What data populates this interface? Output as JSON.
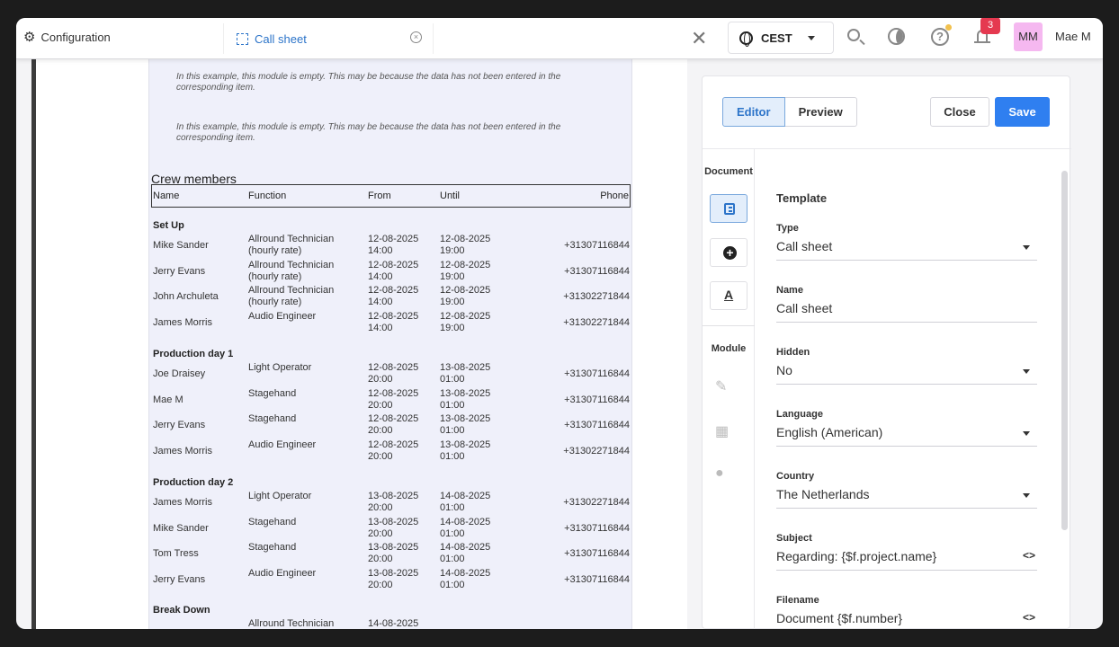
{
  "topbar": {
    "config_label": "Configuration",
    "tab_label": "Call sheet",
    "timezone": "CEST",
    "notification_count": "3",
    "avatar_initials": "MM",
    "username": "Mae M"
  },
  "document": {
    "empty_note": "In this example, this module is empty. This may be because the data has not been entered in the corresponding item.",
    "crew_title": "Crew members",
    "columns": [
      "Name",
      "Function",
      "From",
      "Until",
      "Phone"
    ],
    "sections": [
      {
        "title": "Set Up",
        "rows": [
          {
            "name": "Mike Sander",
            "function": "Allround Technician (hourly rate)",
            "from": "12-08-2025 14:00",
            "until": "12-08-2025 19:00",
            "phone": "+31307116844"
          },
          {
            "name": "Jerry Evans",
            "function": "Allround Technician (hourly rate)",
            "from": "12-08-2025 14:00",
            "until": "12-08-2025 19:00",
            "phone": "+31307116844"
          },
          {
            "name": "John Archuleta",
            "function": "Allround Technician (hourly rate)",
            "from": "12-08-2025 14:00",
            "until": "12-08-2025 19:00",
            "phone": "+31302271844"
          },
          {
            "name": "James Morris",
            "function": "Audio Engineer",
            "from": "12-08-2025 14:00",
            "until": "12-08-2025 19:00",
            "phone": "+31302271844"
          }
        ]
      },
      {
        "title": "Production day 1",
        "rows": [
          {
            "name": "Joe Draisey",
            "function": "Light Operator",
            "from": "12-08-2025 20:00",
            "until": "13-08-2025 01:00",
            "phone": "+31307116844"
          },
          {
            "name": "Mae M",
            "function": "Stagehand",
            "from": "12-08-2025 20:00",
            "until": "13-08-2025 01:00",
            "phone": "+31307116844"
          },
          {
            "name": "Jerry Evans",
            "function": "Stagehand",
            "from": "12-08-2025 20:00",
            "until": "13-08-2025 01:00",
            "phone": "+31307116844"
          },
          {
            "name": "James Morris",
            "function": "Audio Engineer",
            "from": "12-08-2025 20:00",
            "until": "13-08-2025 01:00",
            "phone": "+31302271844"
          }
        ]
      },
      {
        "title": "Production day 2",
        "rows": [
          {
            "name": "James Morris",
            "function": "Light Operator",
            "from": "13-08-2025 20:00",
            "until": "14-08-2025 01:00",
            "phone": "+31302271844"
          },
          {
            "name": "Mike Sander",
            "function": "Stagehand",
            "from": "13-08-2025 20:00",
            "until": "14-08-2025 01:00",
            "phone": "+31307116844"
          },
          {
            "name": "Tom Tress",
            "function": "Stagehand",
            "from": "13-08-2025 20:00",
            "until": "14-08-2025 01:00",
            "phone": "+31307116844"
          },
          {
            "name": "Jerry Evans",
            "function": "Audio Engineer",
            "from": "13-08-2025 20:00",
            "until": "14-08-2025 01:00",
            "phone": "+31307116844"
          }
        ]
      },
      {
        "title": "Break Down",
        "rows": [
          {
            "name": "",
            "function": "Allround Technician",
            "from": "14-08-2025",
            "until": "",
            "phone": ""
          }
        ]
      }
    ]
  },
  "panel": {
    "editor_label": "Editor",
    "preview_label": "Preview",
    "close_label": "Close",
    "save_label": "Save",
    "document_label": "Document",
    "module_label": "Module",
    "template_heading": "Template",
    "fields": {
      "type": {
        "label": "Type",
        "value": "Call sheet"
      },
      "name": {
        "label": "Name",
        "value": "Call sheet"
      },
      "hidden": {
        "label": "Hidden",
        "value": "No"
      },
      "language": {
        "label": "Language",
        "value": "English (American)"
      },
      "country": {
        "label": "Country",
        "value": "The Netherlands"
      },
      "subject": {
        "label": "Subject",
        "value": "Regarding: {$f.project.name}"
      },
      "filename": {
        "label": "Filename",
        "value": "Document {$f.number}"
      }
    },
    "colors": {
      "accent": "#2f7ff0",
      "active_bg": "#e3eefb"
    }
  }
}
